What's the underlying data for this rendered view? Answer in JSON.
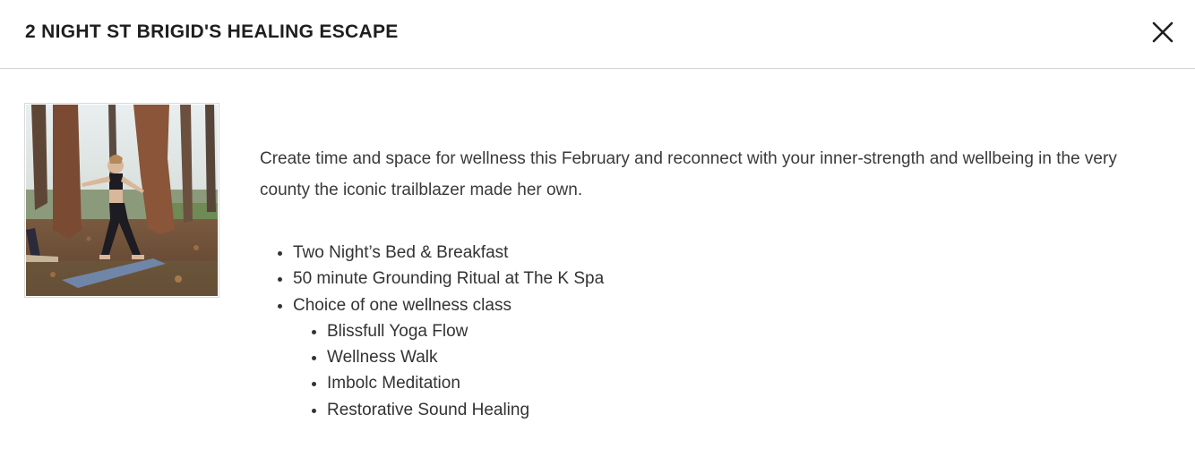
{
  "modal": {
    "title": "2 NIGHT ST BRIGID'S HEALING ESCAPE",
    "close_icon": "close-icon"
  },
  "image": {
    "subject": "yoga-in-forest-photo"
  },
  "content": {
    "intro": "Create time and space for wellness this February and reconnect with your inner-strength and wellbeing in the very county the iconic trailblazer made her own.",
    "features": [
      "Two Night’s Bed & Breakfast",
      "50 minute Grounding Ritual at The K Spa",
      "Choice of one wellness class"
    ],
    "classes": [
      "Blissfull Yoga Flow",
      "Wellness Walk",
      "Imbolc Meditation",
      "Restorative Sound Healing"
    ]
  },
  "colors": {
    "title": "#1e1e1e",
    "text": "#333333",
    "divider": "#d4d4d4",
    "background": "#ffffff"
  }
}
